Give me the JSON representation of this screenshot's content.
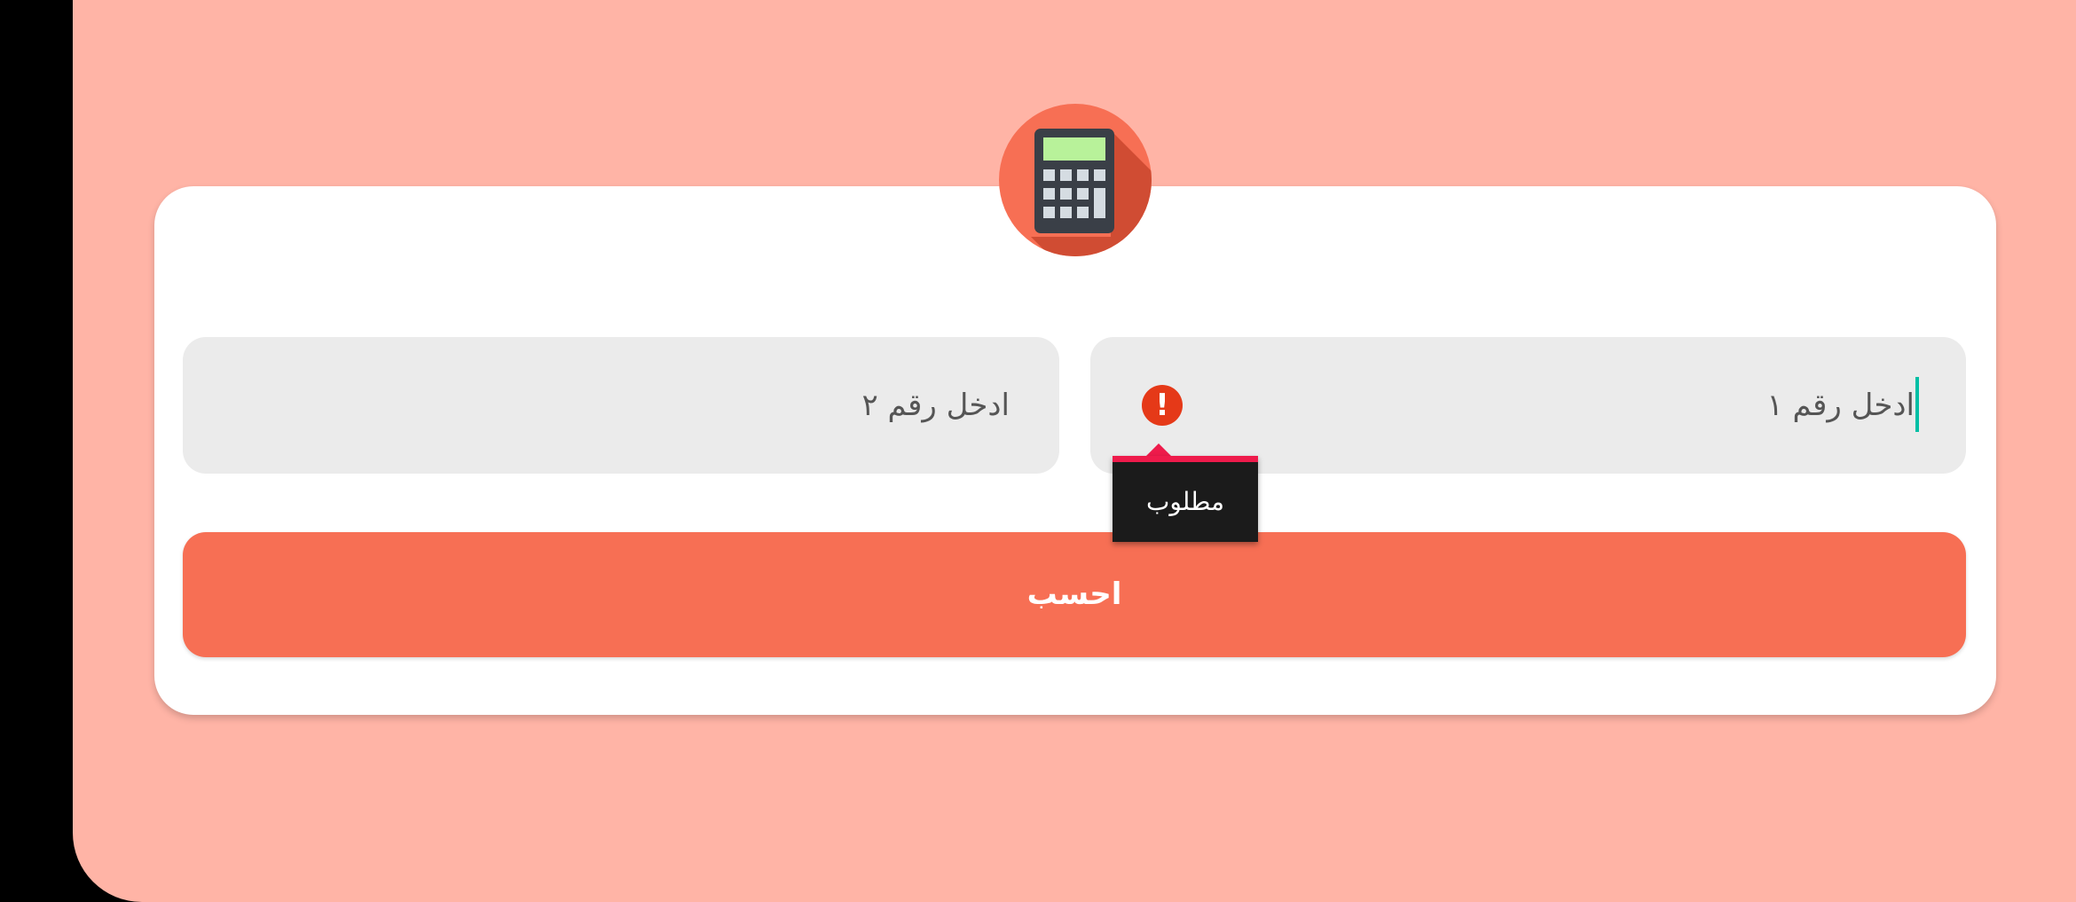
{
  "app": {
    "icon": "calculator-icon",
    "colors": {
      "background": "#FFB4A6",
      "card": "#FFFFFF",
      "accent": "#F76F54",
      "field": "#EBEBEB",
      "error": "#E53918",
      "tooltip_bg": "#1B1B1B",
      "tooltip_accent": "#EE1B4B",
      "cursor": "#00BFA5"
    }
  },
  "form": {
    "number1": {
      "placeholder": "ادخل رقم ١",
      "value": "",
      "error_icon": "error-icon"
    },
    "number2": {
      "placeholder": "ادخل رقم ٢",
      "value": ""
    },
    "error_tooltip": "مطلوب",
    "calculate_label": "احسب"
  }
}
